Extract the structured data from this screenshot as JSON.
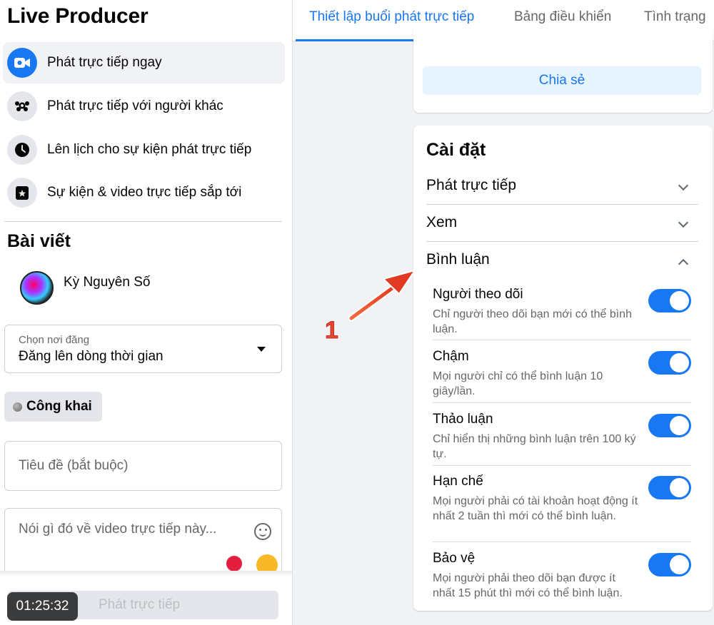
{
  "app": {
    "title": "Live Producer"
  },
  "sidebar": {
    "items": [
      {
        "label": "Phát trực tiếp ngay",
        "icon": "video-camera-icon"
      },
      {
        "label": "Phát trực tiếp với người khác",
        "icon": "group-icon"
      },
      {
        "label": "Lên lịch cho sự kiện phát trực tiếp",
        "icon": "clock-icon"
      },
      {
        "label": "Sự kiện & video trực tiếp sắp tới",
        "icon": "calendar-star-icon"
      }
    ]
  },
  "post": {
    "heading": "Bài viết",
    "author_name": "Kỳ Nguyên Số",
    "where_label": "Chọn nơi đăng",
    "where_value": "Đăng lên dòng thời gian",
    "privacy": "Công khai",
    "title_placeholder": "Tiêu đề (bắt buộc)",
    "desc_placeholder": "Nói gì đó về video trực tiếp này..."
  },
  "footer": {
    "timer": "01:25:32",
    "go_live_label": "Phát trực tiếp"
  },
  "tabs": [
    {
      "label": "Thiết lập buổi phát trực tiếp",
      "active": true
    },
    {
      "label": "Bảng điều khiển",
      "active": false
    },
    {
      "label": "Tình trạng",
      "active": false
    }
  ],
  "share": {
    "label": "Chia sẻ"
  },
  "settings": {
    "title": "Cài đặt",
    "sections": [
      {
        "label": "Phát trực tiếp",
        "expanded": false
      },
      {
        "label": "Xem",
        "expanded": false
      },
      {
        "label": "Bình luận",
        "expanded": true
      }
    ],
    "comment_options": [
      {
        "title": "Người theo dõi",
        "desc": "Chỉ người theo dõi bạn mới có thể bình luận.",
        "on": true
      },
      {
        "title": "Chậm",
        "desc": "Mọi người chỉ có thể bình luận 10 giây/lần.",
        "on": true
      },
      {
        "title": "Thảo luận",
        "desc": "Chỉ hiển thị những bình luận trên 100 ký tự.",
        "on": true
      },
      {
        "title": "Hạn chế",
        "desc": "Mọi người phải có tài khoản hoạt động ít nhất 2 tuần thì mới có thể bình luận.",
        "on": true
      },
      {
        "title": "Bảo vệ",
        "desc": "Mọi người phải theo dõi bạn được ít nhất 15 phút thì mới có thể bình luận.",
        "on": true
      }
    ]
  },
  "annotation": {
    "label": "1",
    "color": "#e8452c"
  },
  "colors": {
    "accent": "#1877f2",
    "panel_bg": "#f0f2f5"
  }
}
